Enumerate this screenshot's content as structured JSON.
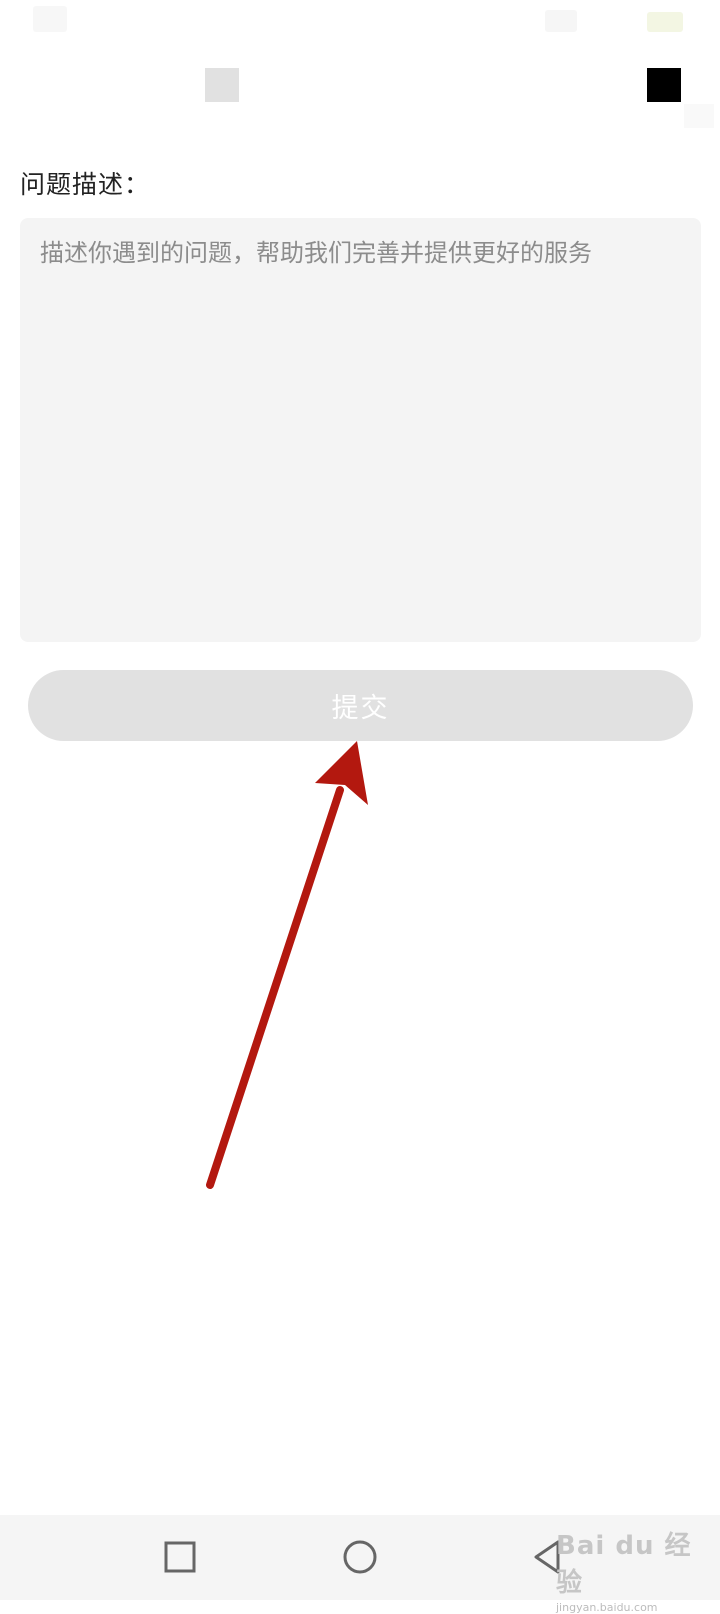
{
  "form": {
    "label": "问题描述：",
    "description_placeholder": "描述你遇到的问题，帮助我们完善并提供更好的服务",
    "description_value": "",
    "submit_label": "提交"
  },
  "colors": {
    "input_bg": "#f4f4f4",
    "button_bg": "#e1e1e1",
    "annotation_arrow": "#b3180f"
  },
  "system_nav": {
    "recent_icon": "square-icon",
    "home_icon": "circle-icon",
    "back_icon": "triangle-back-icon"
  },
  "watermark": {
    "logo": "Bai du 经验",
    "url": "jingyan.baidu.com"
  }
}
